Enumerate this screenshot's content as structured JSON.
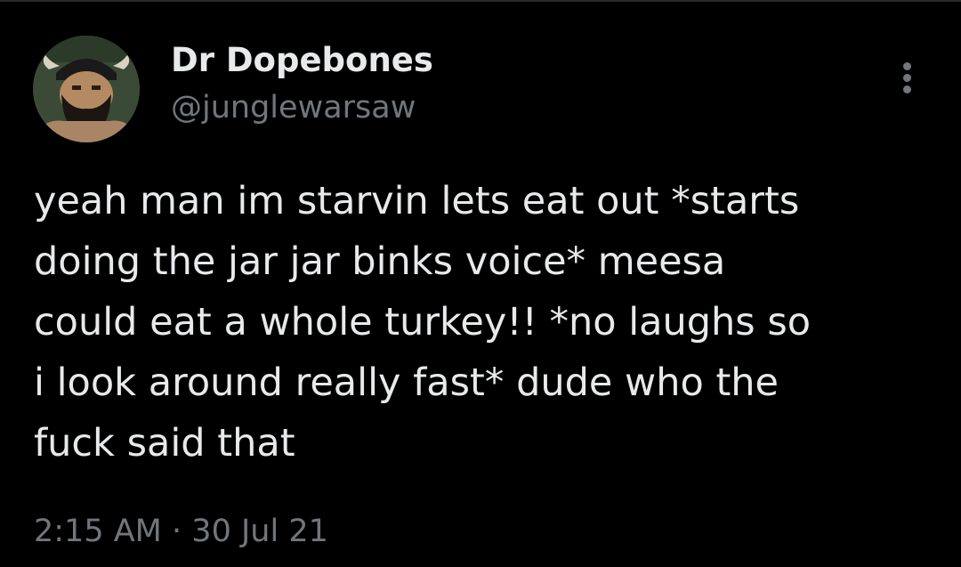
{
  "tweet": {
    "author": {
      "display_name": "Dr Dopebones",
      "handle": "@junglewarsaw"
    },
    "text_lines": [
      "yeah man im starvin lets eat out *starts",
      "doing the jar jar binks voice* meesa",
      "could eat a whole turkey!! *no laughs so",
      "i look around really fast* dude who the",
      "fuck said that"
    ],
    "time": "2:15 AM",
    "separator": "·",
    "date": "30 Jul 21"
  },
  "icons": {
    "more": "more-vertical-icon"
  },
  "colors": {
    "background": "#000000",
    "primary_text": "#e7e9ea",
    "secondary_text": "#71767b"
  }
}
